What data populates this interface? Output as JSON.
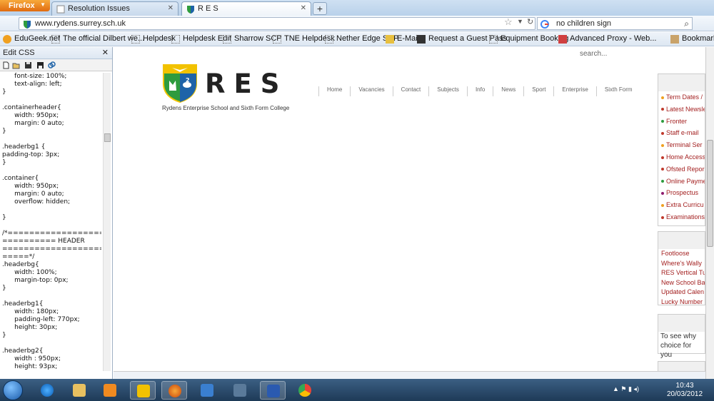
{
  "browser": {
    "menu_label": "Firefox",
    "tabs": [
      {
        "title": "Resolution Issues"
      },
      {
        "title": "R E S"
      }
    ],
    "url": "www.rydens.surrey.sch.uk",
    "search_value": "no children sign",
    "bookmarks": [
      "EduGeek.net",
      "The official Dilbert we...",
      "Helpdesk",
      "Helpdesk Edit",
      "Sharrow SCP",
      "TNE Helpdesk",
      "Nether Edge SCP",
      "E-Mail",
      "Request a Guest Pass",
      "Equipment Booking",
      "Advanced Proxy - Web...",
      "Bookmarks"
    ]
  },
  "sidebar": {
    "title": "Edit CSS",
    "css_lines": [
      "      font-size: 100%;",
      "      text-align: left;",
      "}",
      "",
      ".containerheader{",
      "      width: 950px;",
      "      margin: 0 auto;",
      "}",
      "",
      ".headerbg1 {",
      "padding-top: 3px;",
      "}",
      "",
      ".container{",
      "      width: 950px;",
      "      margin: 0 auto;",
      "      overflow: hidden;",
      "",
      "}",
      "",
      "/*=======================",
      "========== HEADER",
      "=======================",
      "=====*/",
      ".headerbg{",
      "      width: 100%;",
      "      margin-top: 0px;",
      "}",
      "",
      ".headerbg1{",
      "      width: 180px;",
      "      padding-left: 770px;",
      "      height: 30px;",
      "}",
      "",
      ".headerbg2{",
      "      width : 950px;",
      "      height: 93px;",
      "}"
    ]
  },
  "page": {
    "search_placeholder": "search...",
    "logo_text": "RES",
    "tagline": "Rydens Enterprise School and Sixth Form College",
    "menu": [
      "Home",
      "Vacancies",
      "Contact",
      "Subjects",
      "Info",
      "News",
      "Sport",
      "Enterprise",
      "Sixth Form"
    ],
    "quick_links": [
      {
        "label": "Term Dates /",
        "bullet": "#f0a020"
      },
      {
        "label": "Latest Newsle",
        "bullet": "#c0392b"
      },
      {
        "label": "Fronter",
        "bullet": "#2e9b3e"
      },
      {
        "label": "Staff e-mail",
        "bullet": "#c0392b"
      },
      {
        "label": "Terminal Ser",
        "bullet": "#f0a020"
      },
      {
        "label": "Home Access",
        "bullet": "#c0392b"
      },
      {
        "label": "Ofsted Repor",
        "bullet": "#c0392b"
      },
      {
        "label": "Online Payme",
        "bullet": "#2e9b3e"
      },
      {
        "label": "Prospectus",
        "bullet": "#8e1b6e"
      },
      {
        "label": "Extra Curricu",
        "bullet": "#f0a020"
      },
      {
        "label": "Examinations",
        "bullet": "#c0392b"
      }
    ],
    "news_links": [
      "Footloose",
      "Where's Wally",
      "RES Vertical Tu",
      "New School Ba",
      "Updated Calen",
      "Lucky Number"
    ],
    "promo_text": "To see why choice for you"
  },
  "taskbar": {
    "time": "10:43",
    "date": "20/03/2012"
  }
}
